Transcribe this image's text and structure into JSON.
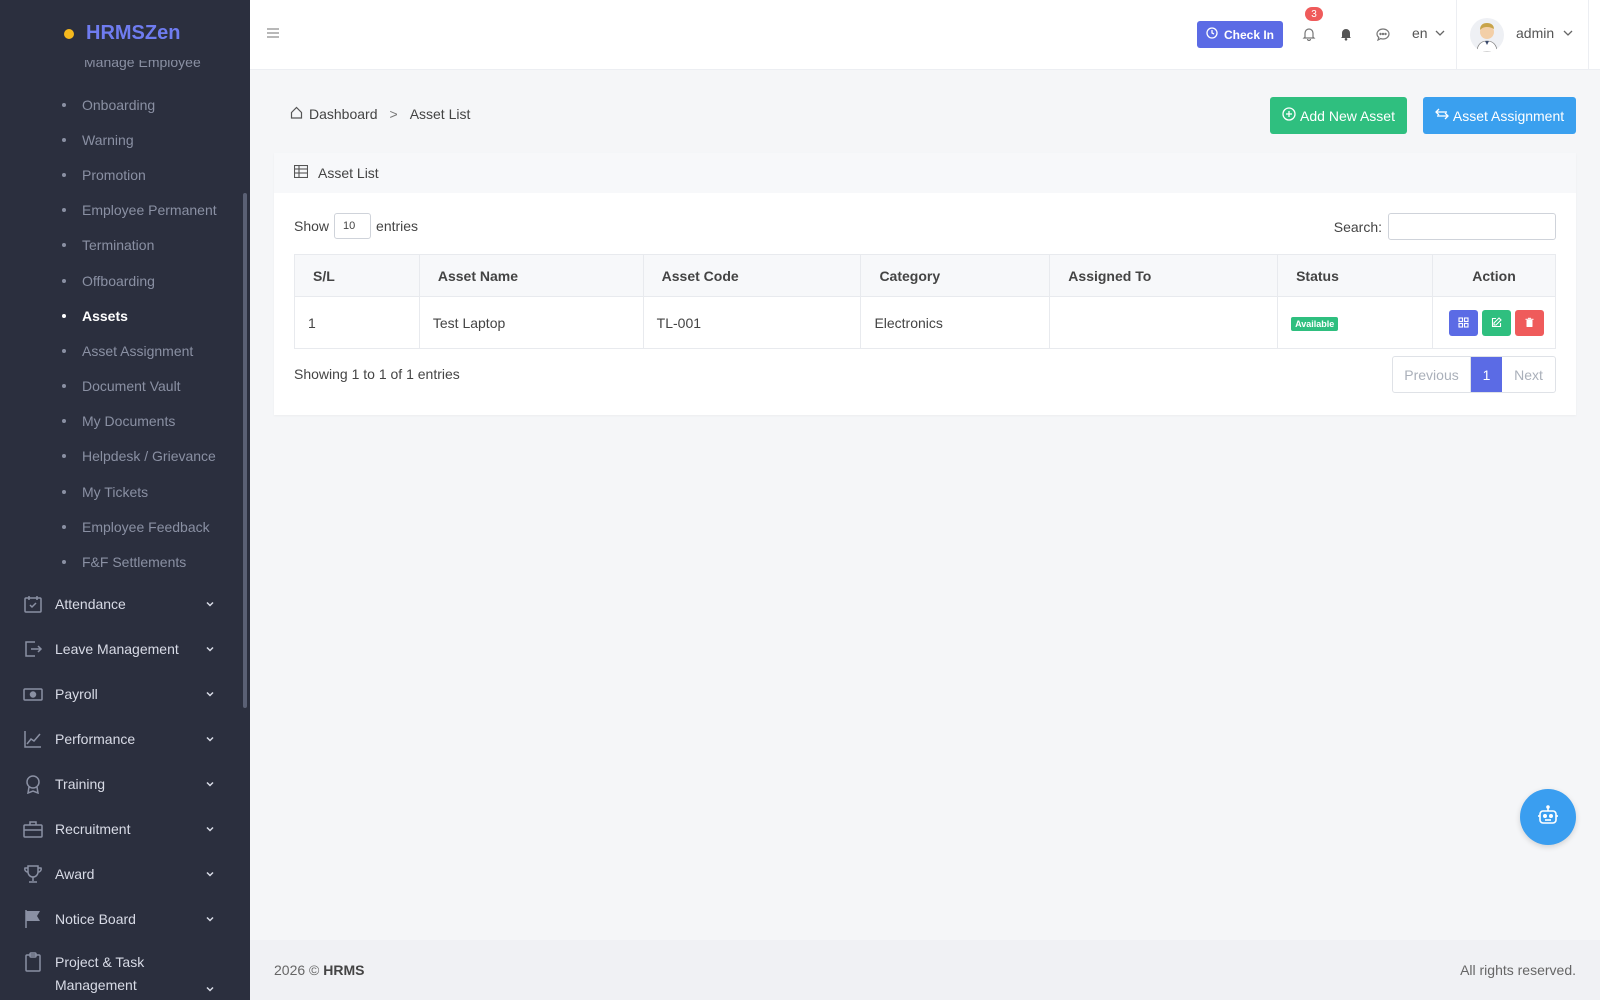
{
  "brand": {
    "name": "HRMSZen"
  },
  "sidebar": {
    "cut_item": "Manage Employee",
    "sub_items": [
      {
        "label": "Onboarding",
        "active": false
      },
      {
        "label": "Warning",
        "active": false
      },
      {
        "label": "Promotion",
        "active": false
      },
      {
        "label": "Employee Permanent",
        "active": false
      },
      {
        "label": "Termination",
        "active": false
      },
      {
        "label": "Offboarding",
        "active": false
      },
      {
        "label": "Assets",
        "active": true
      },
      {
        "label": "Asset Assignment",
        "active": false
      },
      {
        "label": "Document Vault",
        "active": false
      },
      {
        "label": "My Documents",
        "active": false
      },
      {
        "label": "Helpdesk / Grievance",
        "active": false
      },
      {
        "label": "My Tickets",
        "active": false
      },
      {
        "label": "Employee Feedback",
        "active": false
      },
      {
        "label": "F&F Settlements",
        "active": false
      }
    ],
    "menu": [
      {
        "label": "Attendance",
        "icon": "calendar-check-icon"
      },
      {
        "label": "Leave Management",
        "icon": "leave-icon"
      },
      {
        "label": "Payroll",
        "icon": "money-icon"
      },
      {
        "label": "Performance",
        "icon": "chart-line-icon"
      },
      {
        "label": "Training",
        "icon": "award-ribbon-icon"
      },
      {
        "label": "Recruitment",
        "icon": "briefcase-icon"
      },
      {
        "label": "Award",
        "icon": "trophy-icon"
      },
      {
        "label": "Notice Board",
        "icon": "flag-icon"
      },
      {
        "label": "Project & Task Management",
        "icon": "clipboard-icon"
      }
    ]
  },
  "header": {
    "checkin_label": "Check In",
    "notification_count": "3",
    "language": "en",
    "user_name": "admin"
  },
  "breadcrumb": {
    "home": "Dashboard",
    "separator": ">",
    "current": "Asset List"
  },
  "actions": {
    "add_label": "Add New Asset",
    "assign_label": "Asset Assignment"
  },
  "card": {
    "title": "Asset List",
    "show_label": "Show",
    "entries_value": "10",
    "entries_label": "entries",
    "search_label": "Search:"
  },
  "table": {
    "columns": [
      "S/L",
      "Asset Name",
      "Asset Code",
      "Category",
      "Assigned To",
      "Status",
      "Action"
    ],
    "rows": [
      {
        "sl": "1",
        "name": "Test Laptop",
        "code": "TL-001",
        "category": "Electronics",
        "assigned_to": "",
        "status": "Available"
      }
    ]
  },
  "pagination": {
    "info": "Showing 1 to 1 of 1 entries",
    "previous": "Previous",
    "current": "1",
    "next": "Next"
  },
  "footer": {
    "year_text": "2026 ©",
    "brand": "HRMS",
    "rights": "All rights reserved."
  },
  "colors": {
    "primary": "#5b6be5",
    "success": "#2fbf7f",
    "info": "#3aa0ef",
    "danger": "#ef5b5b",
    "sidebar_bg": "#2b2f3e"
  }
}
